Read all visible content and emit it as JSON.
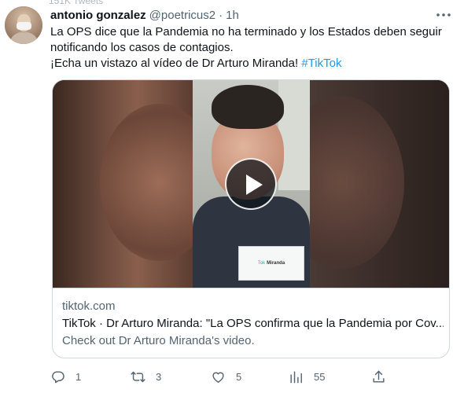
{
  "tweet": {
    "top_cut_text": "151K Tweets",
    "author_name": "antonio gonzalez",
    "author_handle": "@poetricus2",
    "separator": "·",
    "time": "1h",
    "text_lines": [
      "La OPS dice que la Pandemia no ha terminado y los Estados deben seguir",
      "notificando los casos de contagios.",
      "¡Echa un vistazo al vídeo de Dr Arturo Miranda! "
    ],
    "hashtag": "#TikTok",
    "more_icon": "more-dots-icon"
  },
  "card": {
    "domain": "tiktok.com",
    "title": "TikTok · Dr Arturo Miranda: \"La OPS confirma que la Pandemia por Cov...",
    "description": "Check out Dr Arturo Miranda's video.",
    "video_sign_brand": "Tok",
    "video_sign_name": "Miranda",
    "play_icon": "play-icon"
  },
  "actions": {
    "reply_count": "1",
    "retweet_count": "3",
    "like_count": "5",
    "views_count": "55",
    "icons": [
      "reply-icon",
      "retweet-icon",
      "like-icon",
      "views-icon",
      "share-icon"
    ]
  },
  "colors": {
    "accent": "#1d9bf0",
    "muted": "#536471",
    "text": "#0f1419",
    "border": "#cfd9de"
  }
}
